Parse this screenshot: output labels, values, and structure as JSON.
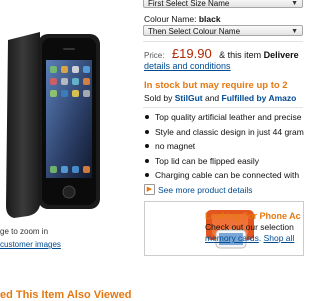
{
  "image": {
    "zoom_hint": "ge to zoom in",
    "customer_images_link": "customer images"
  },
  "size_select": {
    "value": "First Select Size Name"
  },
  "colour": {
    "label": "Colour Name:",
    "value": "black"
  },
  "colour_select": {
    "value": "Then Select Colour Name"
  },
  "price": {
    "label": "Price:",
    "value": "£19.90",
    "note_prefix": "& this item",
    "note_bold": "Delivere"
  },
  "delivery_link": "details and conditions",
  "stock_text": "In stock but may require up to 2",
  "sold_by": {
    "prefix": "Sold by",
    "seller": "StilGut",
    "and": "and",
    "fulfilled": "Fulfilled by Amazo"
  },
  "features": [
    "Top quality artificial leather and precise",
    "Style and classic design in just 44 gram",
    "no magnet",
    "Top lid can be flipped easily",
    "Charging cable can be connected with"
  ],
  "more_details": "See more product details",
  "promo": {
    "title": "Looking For Phone Ac",
    "text": "Check out our selection",
    "link1": "memory cards",
    "link2": "Shop all"
  },
  "also_viewed": "ed This Item Also Viewed",
  "colors": {
    "accent": "#e47911",
    "price": "#b12704",
    "link": "#004b91"
  }
}
